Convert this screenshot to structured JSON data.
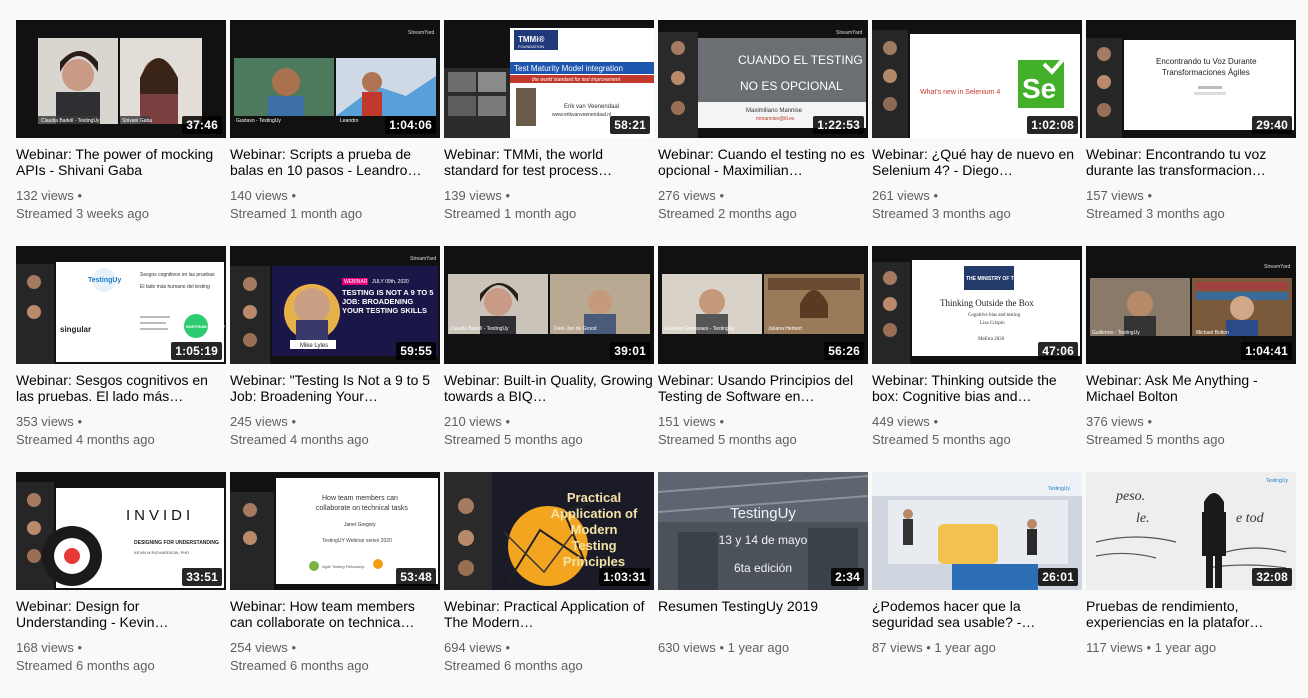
{
  "videos": [
    {
      "title": "Webinar: The power of mocking APIs - Shivani Gaba",
      "duration": "37:46",
      "views": "132 views",
      "separator": "•",
      "time": "Streamed 3 weeks ago",
      "thumb_text": [
        "Claudia Badell - TestingUy",
        "Shivani Gaba"
      ]
    },
    {
      "title": "Webinar: Scripts a prueba de balas en 10 pasos - Leandro…",
      "duration": "1:04:06",
      "views": "140 views",
      "separator": "•",
      "time": "Streamed 1 month ago",
      "thumb_text": [
        "StreamYard",
        "Gustavo - TestingUy",
        "Leandro"
      ]
    },
    {
      "title": "Webinar: TMMi, the world standard for test process…",
      "duration": "58:21",
      "views": "139 views",
      "separator": "•",
      "time": "Streamed 1 month ago",
      "thumb_text": [
        "TMMi®",
        "FOUNDATION",
        "Test Maturity Model integration",
        "the world standard for test improvement",
        "Erik van Veenendaal",
        "www.erikvanveenendaal.nl"
      ]
    },
    {
      "title": "Webinar: Cuando el testing no es opcional - Maximilian…",
      "duration": "1:22:53",
      "views": "276 views",
      "separator": "•",
      "time": "Streamed 2 months ago",
      "thumb_text": [
        "StreamYard",
        "CUANDO EL TESTING",
        "NO ES OPCIONAL",
        "Maximiliano Mannise",
        "mmannise@itl.es"
      ]
    },
    {
      "title": "Webinar: ¿Qué hay de nuevo en Selenium 4? - Diego…",
      "duration": "1:02:08",
      "views": "261 views",
      "separator": "•",
      "time": "Streamed 3 months ago",
      "thumb_text": [
        "What's new in Selenium 4",
        "Se"
      ]
    },
    {
      "title": "Webinar: Encontrando tu voz durante las transformacion…",
      "duration": "29:40",
      "views": "157 views",
      "separator": "•",
      "time": "Streamed 3 months ago",
      "thumb_text": [
        "Encontrando tu Voz Durante",
        "Transformaciones Ágiles"
      ]
    },
    {
      "title": "Webinar: Sesgos cognitivos en las pruebas. El lado más…",
      "duration": "1:05:19",
      "views": "353 views",
      "separator": "•",
      "time": "Streamed 4 months ago",
      "thumb_text": [
        "TestingUy",
        "Sesgos cognitivos en las pruebas",
        "El lado más humano del testing",
        "singular",
        "NORTHUM QUALITY"
      ]
    },
    {
      "title": "Webinar: \"Testing Is Not a 9 to 5 Job: Broadening Your…",
      "duration": "59:55",
      "views": "245 views",
      "separator": "•",
      "time": "Streamed 4 months ago",
      "thumb_text": [
        "StreamYard",
        "WEBINAR",
        "JULY 09th, 2020",
        "TESTING IS NOT A 9 TO 5 JOB: BROADENING YOUR TESTING SKILLS",
        "Mike Lyles"
      ]
    },
    {
      "title": "Webinar: Built-in Quality, Growing towards a BIQ…",
      "duration": "39:01",
      "views": "210 views",
      "separator": "•",
      "time": "Streamed 5 months ago",
      "thumb_text": [
        "Claudia Badell - TestingUy",
        "Derk-Jan de Grood"
      ]
    },
    {
      "title": "Webinar: Usando Principios del Testing de Software en…",
      "duration": "56:26",
      "views": "151 views",
      "separator": "•",
      "time": "Streamed 5 months ago",
      "thumb_text": [
        "Gustavo Guimaraes - TestingUy",
        "Juliana Herbert"
      ]
    },
    {
      "title": "Webinar: Thinking outside the box: Cognitive bias and…",
      "duration": "47:06",
      "views": "449 views",
      "separator": "•",
      "time": "Streamed 5 months ago",
      "thumb_text": [
        "THE MINISTRY OF TESTING",
        "Thinking Outside the Box",
        "Cognitive bias and testing",
        "Lisa Crispin",
        "MeEtra 2020"
      ]
    },
    {
      "title": "Webinar: Ask Me Anything - Michael Bolton",
      "duration": "1:04:41",
      "views": "376 views",
      "separator": "•",
      "time": "Streamed 5 months ago",
      "thumb_text": [
        "StreamYard",
        "Guillermo - TestingUy",
        "Michael Bolton"
      ]
    },
    {
      "title": "Webinar: Design for Understanding - Kevin…",
      "duration": "33:51",
      "views": "168 views",
      "separator": "•",
      "time": "Streamed 6 months ago",
      "thumb_text": [
        "INVIDI",
        "DESIGNING FOR UNDERSTANDING",
        "KEVIN M RICHARDSON, PHD"
      ]
    },
    {
      "title": "Webinar: How team members can collaborate on technica…",
      "duration": "53:48",
      "views": "254 views",
      "separator": "•",
      "time": "Streamed 6 months ago",
      "thumb_text": [
        "How team members can",
        "collaborate on technical tasks",
        "Janet Gregory",
        "TestingUY Webinar series 2020",
        "Agile Testing Fellowship"
      ]
    },
    {
      "title": "Webinar: Practical Application of The Modern…",
      "duration": "1:03:31",
      "views": "694 views",
      "separator": "•",
      "time": "Streamed 6 months ago",
      "thumb_text": [
        "Practical",
        "Application of",
        "Modern",
        "Testing",
        "Principles"
      ]
    },
    {
      "title": "Resumen TestingUy 2019",
      "duration": "2:34",
      "views": "630 views",
      "separator": "•",
      "time": "1 year ago",
      "thumb_text": [
        "TestingUy",
        "13 y 14 de mayo",
        "6ta edición"
      ]
    },
    {
      "title": "¿Podemos hacer que la seguridad sea usable? -…",
      "duration": "26:01",
      "views": "87 views",
      "separator": "•",
      "time": "1 year ago",
      "thumb_text": [
        "TestingUy"
      ]
    },
    {
      "title": "Pruebas de rendimiento, experiencias en la platafor…",
      "duration": "32:08",
      "views": "117 views",
      "separator": "•",
      "time": "1 year ago",
      "thumb_text": [
        "TestingUy",
        "peso.",
        "le.",
        "e tod"
      ]
    }
  ],
  "colors": {
    "background": "#f9f9f9",
    "title": "#030303",
    "meta": "#606060",
    "duration_bg": "#000000"
  }
}
